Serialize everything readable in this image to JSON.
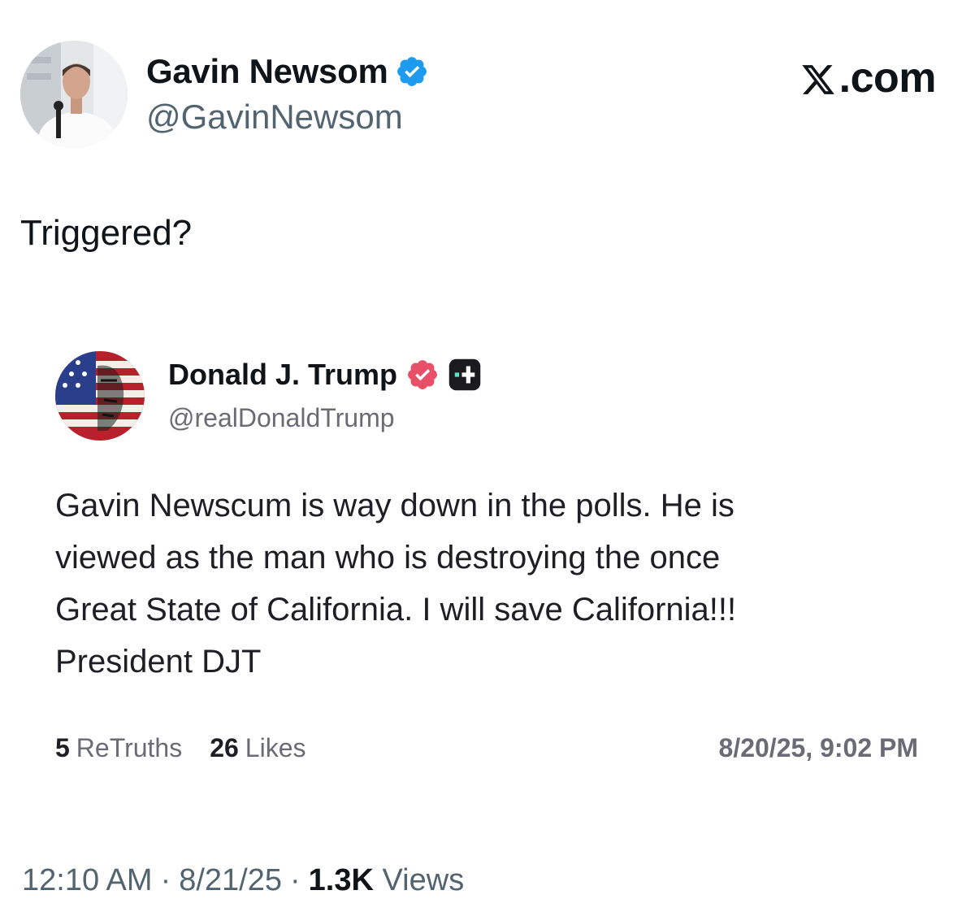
{
  "post": {
    "author": {
      "name": "Gavin Newsom",
      "handle": "@GavinNewsom",
      "verified_color": "#1d9bf0"
    },
    "brand": ".com",
    "brand_icon": "x-logo-icon",
    "text": "Triggered?",
    "footer": {
      "time": "12:10 AM",
      "separator": "·",
      "date": "8/21/25",
      "views_count": "1.3K",
      "views_label": "Views"
    }
  },
  "quoted_post": {
    "author": {
      "name": "Donald J. Trump",
      "handle": "@realDonaldTrump",
      "verified_color": "#e8506a"
    },
    "lines": [
      "Gavin Newscum is way down in the polls. He is",
      "viewed as the man who is destroying the once",
      "Great State of California. I will save California!!!",
      "President DJT"
    ],
    "stats": {
      "retruths_count": "5",
      "retruths_label": "ReTruths",
      "likes_count": "26",
      "likes_label": "Likes"
    },
    "timestamp": "8/20/25, 9:02 PM"
  }
}
